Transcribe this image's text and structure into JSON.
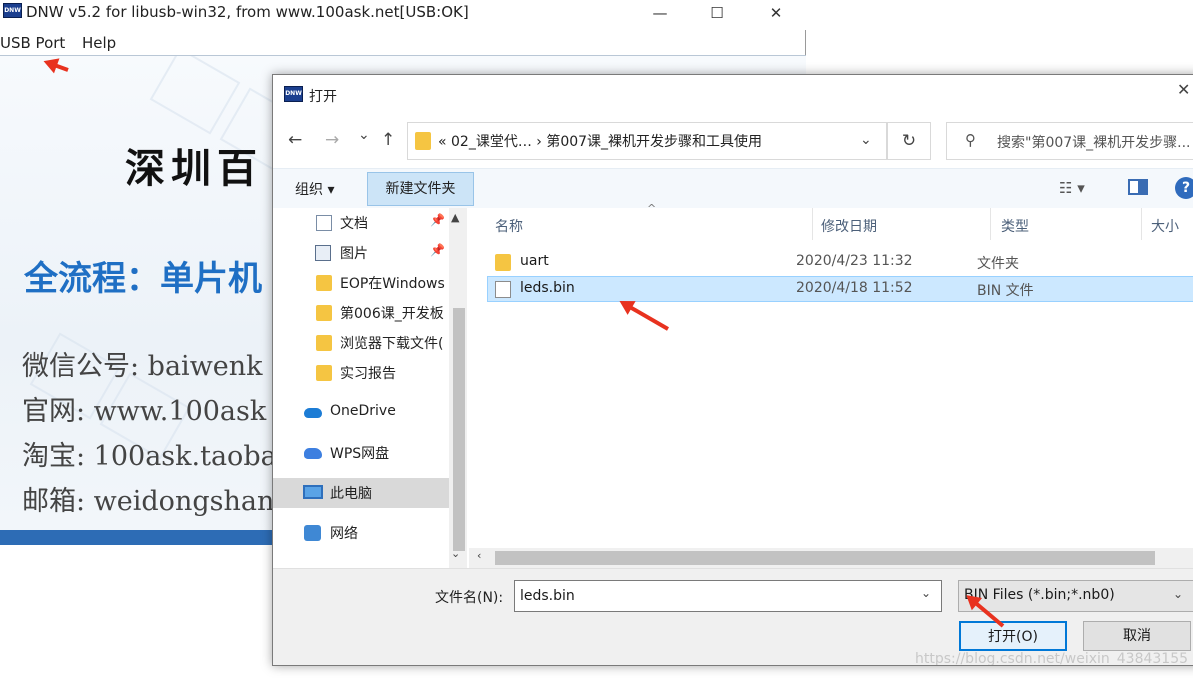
{
  "dnw": {
    "title": "DNW v5.2 for libusb-win32, from www.100ask.net[USB:OK]",
    "app_icon_text": "DNW",
    "caption": {
      "minimize": "—",
      "maximize": "☐",
      "close": "✕"
    },
    "menu": [
      "USB Port",
      "Help"
    ],
    "banner": {
      "title": "深圳百",
      "subtitle": "全流程：单片机",
      "lines": [
        "微信公号: baiwenk",
        "官网: www.100ask",
        "淘宝: 100ask.taoba",
        "邮箱: weidongshan"
      ]
    }
  },
  "dialog": {
    "title": "打开",
    "icon_text": "DNW",
    "close": "✕",
    "nav": {
      "back": "←",
      "forward": "→",
      "recent": "⌄",
      "up": "↑"
    },
    "address": "«  02_课堂代…  ›  第007课_裸机开发步骤和工具使用",
    "address_dropdown": "⌄",
    "refresh": "↻",
    "search_placeholder": "搜索\"第007课_裸机开发步骤...",
    "search_icon": "⚲",
    "organize": "组织 ▾",
    "new_folder": "新建文件夹",
    "view_icon": "☷ ▾",
    "help": "?",
    "nav_items": [
      {
        "label": "文档",
        "icon": "document-icon",
        "pinned": true
      },
      {
        "label": "图片",
        "icon": "picture-icon",
        "pinned": true
      },
      {
        "label": "EOP在Windows",
        "icon": "folder-icon"
      },
      {
        "label": "第006课_开发板",
        "icon": "folder-icon"
      },
      {
        "label": "浏览器下载文件(",
        "icon": "folder-icon"
      },
      {
        "label": "实习报告",
        "icon": "folder-icon"
      },
      {
        "label": "OneDrive",
        "icon": "onedrive-icon"
      },
      {
        "label": "WPS网盘",
        "icon": "wps-cloud-icon"
      },
      {
        "label": "此电脑",
        "icon": "this-pc-icon",
        "selected": true
      },
      {
        "label": "网络",
        "icon": "network-icon"
      }
    ],
    "pin_glyph": "📌",
    "columns": [
      "名称",
      "修改日期",
      "类型",
      "大小"
    ],
    "sort_caret": "^",
    "files": [
      {
        "name": "uart",
        "date": "2020/4/23 11:32",
        "type": "文件夹",
        "icon": "folder-icon"
      },
      {
        "name": "leds.bin",
        "date": "2020/4/18 11:52",
        "type": "BIN 文件",
        "icon": "file-icon",
        "selected": true
      }
    ],
    "scroll": {
      "up": "▲",
      "down": "⌄",
      "left": "‹"
    },
    "filename_label": "文件名(N):",
    "filename_value": "leds.bin",
    "filename_dropdown": "⌄",
    "filetype": "BIN Files (*.bin;*.nb0)",
    "filetype_dropdown": "⌄",
    "open_button": "打开(O)",
    "cancel_button": "取消",
    "watermark": "https://blog.csdn.net/weixin_43843155"
  },
  "colors": {
    "accent": "#0078d7",
    "selection": "#cce8ff",
    "arrow": "#e8321f",
    "banner_blue": "#1f6fc4"
  }
}
